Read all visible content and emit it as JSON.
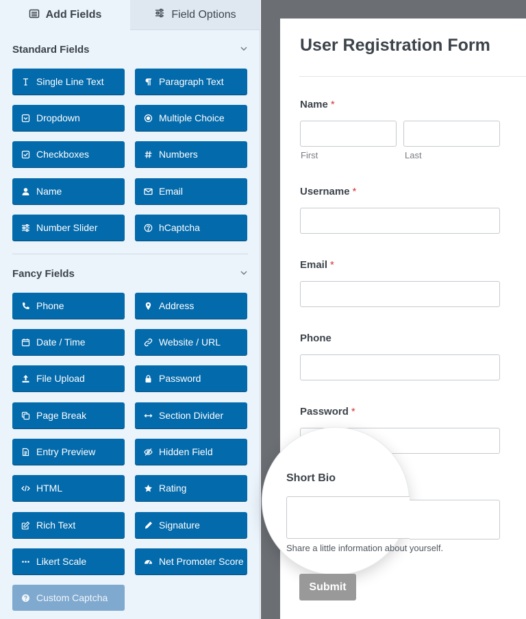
{
  "tabs": [
    {
      "label": "Add Fields",
      "icon": "list-icon",
      "active": true
    },
    {
      "label": "Field Options",
      "icon": "sliders-icon",
      "active": false
    }
  ],
  "sections": {
    "standard": {
      "title": "Standard Fields",
      "items": [
        {
          "label": "Single Line Text",
          "icon": "text-cursor-icon"
        },
        {
          "label": "Paragraph Text",
          "icon": "paragraph-icon"
        },
        {
          "label": "Dropdown",
          "icon": "dropdown-icon"
        },
        {
          "label": "Multiple Choice",
          "icon": "radio-icon"
        },
        {
          "label": "Checkboxes",
          "icon": "checkbox-icon"
        },
        {
          "label": "Numbers",
          "icon": "hash-icon"
        },
        {
          "label": "Name",
          "icon": "user-icon"
        },
        {
          "label": "Email",
          "icon": "envelope-icon"
        },
        {
          "label": "Number Slider",
          "icon": "sliders-icon"
        },
        {
          "label": "hCaptcha",
          "icon": "question-circle-icon"
        }
      ]
    },
    "fancy": {
      "title": "Fancy Fields",
      "items": [
        {
          "label": "Phone",
          "icon": "phone-icon"
        },
        {
          "label": "Address",
          "icon": "map-pin-icon"
        },
        {
          "label": "Date / Time",
          "icon": "calendar-icon"
        },
        {
          "label": "Website / URL",
          "icon": "link-icon"
        },
        {
          "label": "File Upload",
          "icon": "upload-icon"
        },
        {
          "label": "Password",
          "icon": "lock-icon"
        },
        {
          "label": "Page Break",
          "icon": "copy-icon"
        },
        {
          "label": "Section Divider",
          "icon": "arrows-h-icon"
        },
        {
          "label": "Entry Preview",
          "icon": "file-text-icon"
        },
        {
          "label": "Hidden Field",
          "icon": "eye-slash-icon"
        },
        {
          "label": "HTML",
          "icon": "code-icon"
        },
        {
          "label": "Rating",
          "icon": "star-icon"
        },
        {
          "label": "Rich Text",
          "icon": "edit-icon"
        },
        {
          "label": "Signature",
          "icon": "pen-icon"
        },
        {
          "label": "Likert Scale",
          "icon": "ellipsis-icon"
        },
        {
          "label": "Net Promoter Score",
          "icon": "gauge-icon"
        },
        {
          "label": "Custom Captcha",
          "icon": "question-circle-icon",
          "disabled": true
        }
      ]
    }
  },
  "form": {
    "title": "User Registration Form",
    "fields": {
      "name": {
        "label": "Name",
        "required": "*",
        "first": "First",
        "last": "Last"
      },
      "username": {
        "label": "Username",
        "required": "*"
      },
      "email": {
        "label": "Email",
        "required": "*"
      },
      "phone": {
        "label": "Phone"
      },
      "password": {
        "label": "Password",
        "required": "*"
      },
      "short_bio": {
        "label": "Short Bio",
        "help": "Share a little information about yourself."
      }
    },
    "submit_label": "Submit"
  },
  "colors": {
    "button_blue": "#036aab",
    "button_disabled": "#7fa9cf",
    "panel_bg": "#ebf3fb",
    "canvas_bg": "#6b6f74",
    "required_red": "#d63638",
    "submit_gray": "#999999"
  }
}
